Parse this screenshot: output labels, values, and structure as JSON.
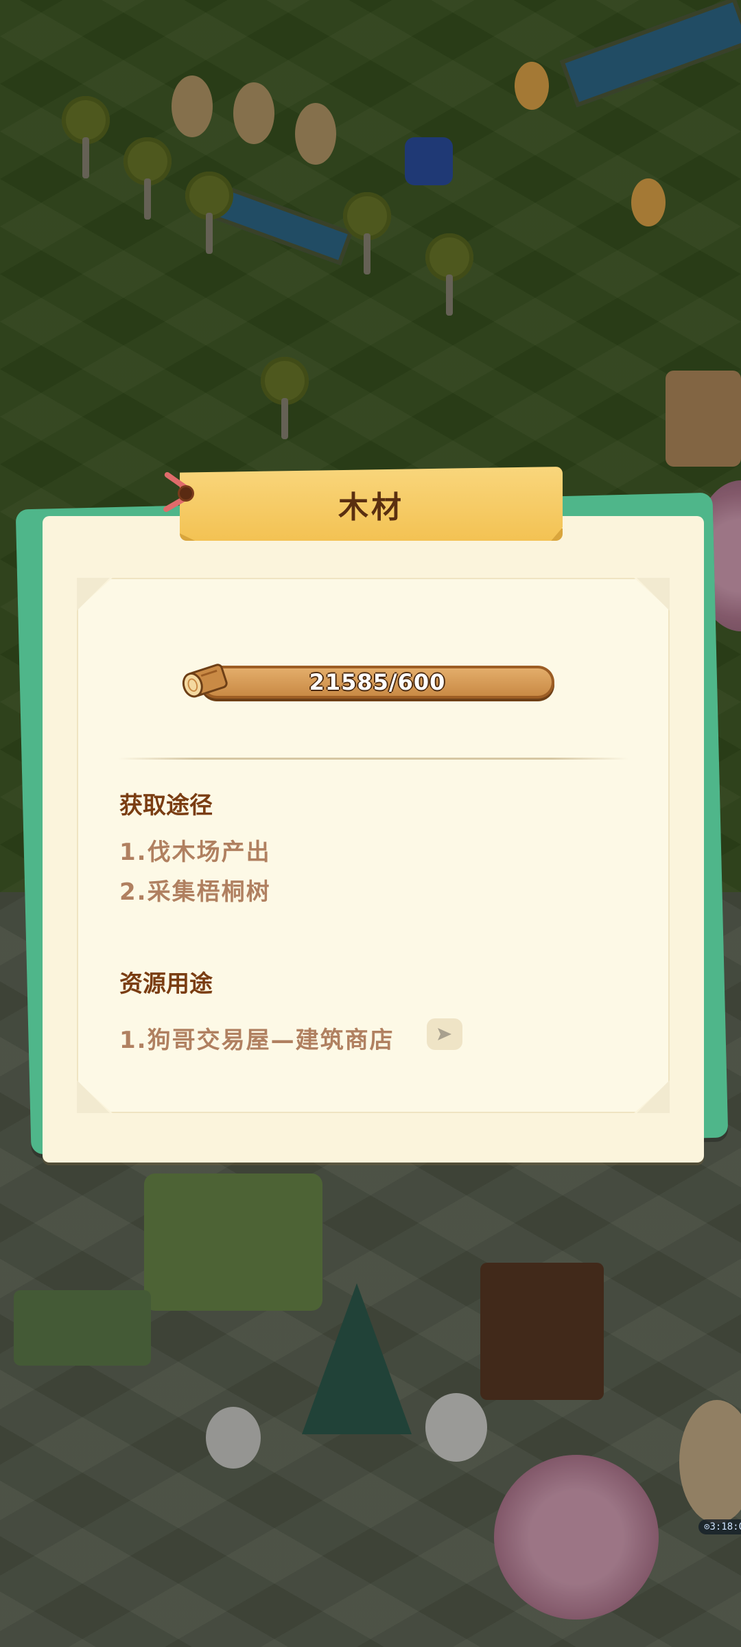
{
  "dialog": {
    "title": "木材",
    "resource": {
      "icon": "wood-log-icon",
      "progress_text": "21585/600",
      "fill_fraction": 1.0
    },
    "obtain_section": {
      "heading": "获取途径",
      "items": [
        "1.伐木场产出",
        "2.采集梧桐树"
      ]
    },
    "usage_section": {
      "heading": "资源用途",
      "items": [
        "1.狗哥交易屋—建筑商店"
      ],
      "go_icon": "play-arrow-icon"
    }
  },
  "status": {
    "timer_text": "3:18:0"
  },
  "colors": {
    "panel": "#fbf4dc",
    "panel_back": "#4fb68a",
    "ribbon": "#f3c253",
    "heading_text": "#7a3d12",
    "item_text": "#b08060",
    "bar": "#9c5d24"
  }
}
